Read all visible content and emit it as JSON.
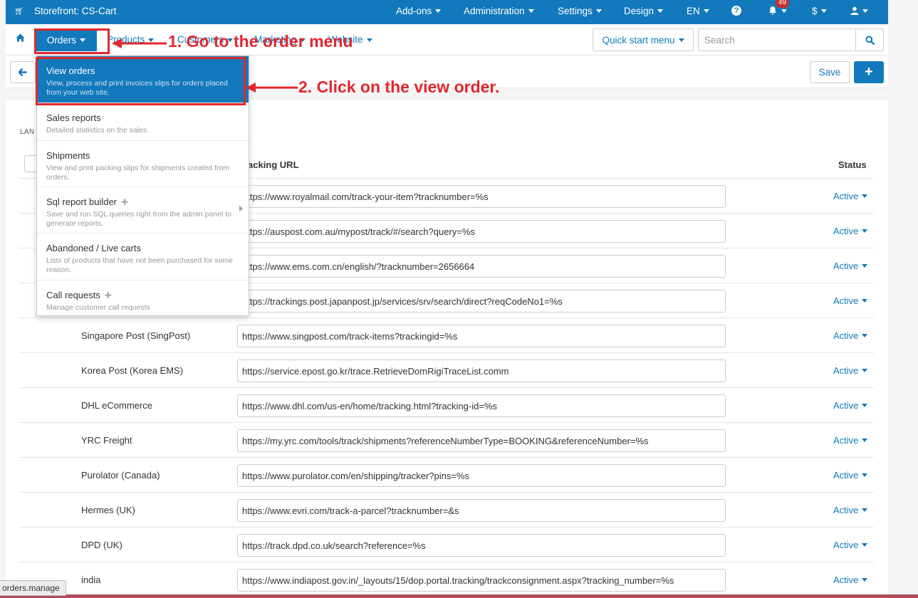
{
  "topbar": {
    "store": "Storefront: CS-Cart",
    "menu": [
      "Add-ons",
      "Administration",
      "Settings",
      "Design",
      "EN"
    ],
    "notifications_count": "49",
    "currency": "$"
  },
  "navbar": {
    "orders": "Orders",
    "products": "Products",
    "customers": "Customers",
    "marketing": "Marketing",
    "website": "Website",
    "quick_start": "Quick start menu",
    "search_placeholder": "Search"
  },
  "actionbar": {
    "save": "Save",
    "add": "+"
  },
  "table": {
    "lang_label": "LAN",
    "col_url": "Tracking URL",
    "col_url_partial": "acking URL",
    "col_status": "Status",
    "rows": [
      {
        "name": "",
        "url": "https://www.royalmail.com/track-your-item?tracknumber=%s",
        "status": "Active"
      },
      {
        "name": "",
        "url": "https://auspost.com.au/mypost/track/#/search?query=%s",
        "status": "Active"
      },
      {
        "name": "",
        "url": "https://www.ems.com.cn/english/?tracknumber=2656664",
        "status": "Active"
      },
      {
        "name": "",
        "url": "https://trackings.post.japanpost.jp/services/srv/search/direct?reqCodeNo1=%s",
        "status": "Active"
      },
      {
        "name": "Singapore Post (SingPost)",
        "url": "https://www.singpost.com/track-items?trackingid=%s",
        "status": "Active"
      },
      {
        "name": "Korea Post (Korea EMS)",
        "url": "https://service.epost.go.kr/trace.RetrieveDomRigiTraceList.comm",
        "status": "Active"
      },
      {
        "name": "DHL eCommerce",
        "url": "https://www.dhl.com/us-en/home/tracking.html?tracking-id=%s",
        "status": "Active"
      },
      {
        "name": "YRC Freight",
        "url": "https://my.yrc.com/tools/track/shipments?referenceNumberType=BOOKING&referenceNumber=%s",
        "status": "Active"
      },
      {
        "name": "Purolator (Canada)",
        "url": "https://www.purolator.com/en/shipping/tracker?pins=%s",
        "status": "Active"
      },
      {
        "name": "Hermes (UK)",
        "url": "https://www.evri.com/track-a-parcel?tracknumber=&s",
        "status": "Active"
      },
      {
        "name": "DPD (UK)",
        "url": "https://track.dpd.co.uk/search?reference=%s",
        "status": "Active"
      },
      {
        "name": "india",
        "url": "https://www.indiapost.gov.in/_layouts/15/dop.portal.tracking/trackconsignment.aspx?tracking_number=%s",
        "status": "Active"
      }
    ]
  },
  "dropdown": [
    {
      "title": "View orders",
      "desc": "View, process and print invoices slips for orders placed from your web site."
    },
    {
      "title": "Sales reports",
      "desc": "Detailed statistics on the sales."
    },
    {
      "title": "Shipments",
      "desc": "View and print packing slips for shipments created from orders."
    },
    {
      "title": "Sql report builder",
      "desc": "Save and run SQL queries right from the admin panel to generate reports."
    },
    {
      "title": "Abandoned / Live carts",
      "desc": "Lists of products that have not been purchased for some reason."
    },
    {
      "title": "Call requests",
      "desc": "Manage customer call requests"
    }
  ],
  "annotations": {
    "step1": "1. Go to the order menu",
    "step2": "2. Click on the view order."
  },
  "statusbar": "orders.manage",
  "colors": {
    "primary": "#1279bc",
    "annotation": "#e0282e"
  }
}
